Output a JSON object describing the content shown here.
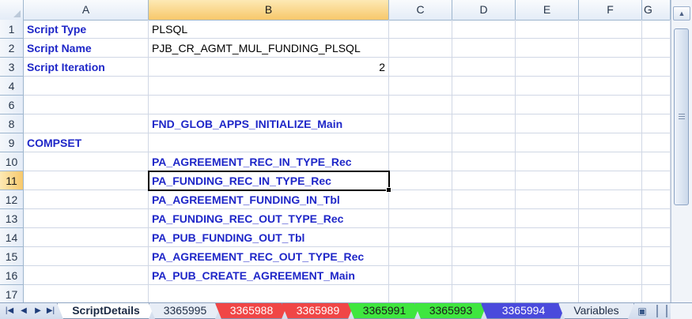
{
  "columns": [
    {
      "label": "A",
      "selected": false
    },
    {
      "label": "B",
      "selected": true
    },
    {
      "label": "C",
      "selected": false
    },
    {
      "label": "D",
      "selected": false
    },
    {
      "label": "E",
      "selected": false
    },
    {
      "label": "F",
      "selected": false
    },
    {
      "label": "G",
      "selected": false
    }
  ],
  "rows": [
    {
      "num": "1",
      "a": "Script Type",
      "b": "PLSQL"
    },
    {
      "num": "2",
      "a": "Script Name",
      "b": "PJB_CR_AGMT_MUL_FUNDING_PLSQL"
    },
    {
      "num": "3",
      "a": "Script Iteration",
      "b": "2"
    },
    {
      "num": "4",
      "a": "",
      "b": ""
    },
    {
      "num": "6",
      "a": "",
      "b": ""
    },
    {
      "num": "8",
      "a": "",
      "b": "FND_GLOB_APPS_INITIALIZE_Main"
    },
    {
      "num": "9",
      "a": "COMPSET",
      "b": ""
    },
    {
      "num": "10",
      "a": "",
      "b": "PA_AGREEMENT_REC_IN_TYPE_Rec"
    },
    {
      "num": "11",
      "a": "",
      "b": "PA_FUNDING_REC_IN_TYPE_Rec"
    },
    {
      "num": "12",
      "a": "",
      "b": "PA_AGREEMENT_FUNDING_IN_Tbl"
    },
    {
      "num": "13",
      "a": "",
      "b": "PA_FUNDING_REC_OUT_TYPE_Rec"
    },
    {
      "num": "14",
      "a": "",
      "b": "PA_PUB_FUNDING_OUT_Tbl"
    },
    {
      "num": "15",
      "a": "",
      "b": "PA_AGREEMENT_REC_OUT_TYPE_Rec"
    },
    {
      "num": "16",
      "a": "",
      "b": "PA_PUB_CREATE_AGREEMENT_Main"
    },
    {
      "num": "17",
      "a": "",
      "b": ""
    }
  ],
  "active_cell": {
    "row": "11",
    "column": "B"
  },
  "sheet_tabs": [
    {
      "label": "ScriptDetails",
      "color": "active"
    },
    {
      "label": "3365995",
      "color": "plain"
    },
    {
      "label": "3365988",
      "color": "red"
    },
    {
      "label": "3365989",
      "color": "red"
    },
    {
      "label": "3365991",
      "color": "green"
    },
    {
      "label": "3365993",
      "color": "green"
    },
    {
      "label": "3365994",
      "color": "blue"
    },
    {
      "label": "Variables",
      "color": "plain"
    }
  ],
  "icons": {
    "nav_first": "first-sheet-icon",
    "nav_prev": "prev-sheet-icon",
    "nav_next": "next-sheet-icon",
    "nav_last": "last-sheet-icon",
    "new_sheet": "insert-worksheet-icon",
    "scroll_up": "scroll-up-icon",
    "scroll_down": "scroll-down-icon"
  },
  "colors": {
    "label_blue": "#1f27c8",
    "red_tab": "#f04646",
    "green_tab": "#3fe63f",
    "blue_tab": "#4a4adc",
    "header_selected": "#f7c86b"
  }
}
